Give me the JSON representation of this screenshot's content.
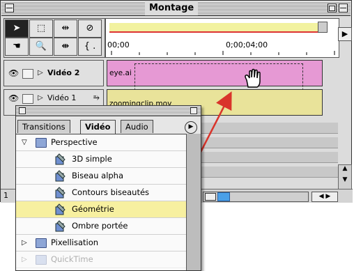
{
  "window": {
    "title": "Montage"
  },
  "ruler": {
    "time_start": "00;00",
    "time_mark": "0;00;04;00"
  },
  "tracks": [
    {
      "name": "Vidéo 2",
      "clip": "eye.ai"
    },
    {
      "name": "Vidéo 1",
      "clip": "zoomingclip.mov"
    }
  ],
  "bottom": {
    "left_label": "1"
  },
  "effects_palette": {
    "tabs": [
      "Transitions",
      "Vidéo",
      "Audio"
    ],
    "active_tab": "Vidéo",
    "items": [
      {
        "label": "Perspective",
        "type": "folder",
        "expanded": true
      },
      {
        "label": "3D simple",
        "type": "effect"
      },
      {
        "label": "Biseau alpha",
        "type": "effect"
      },
      {
        "label": "Contours biseautés",
        "type": "effect"
      },
      {
        "label": "Géométrie",
        "type": "effect",
        "highlighted": true
      },
      {
        "label": "Ombre portée",
        "type": "effect"
      },
      {
        "label": "Pixellisation",
        "type": "folder",
        "expanded": false
      },
      {
        "label": "QuickTime",
        "type": "folder",
        "expanded": false
      }
    ]
  },
  "colors": {
    "clip_ai": "#e699d4",
    "clip_mov": "#e9e39a",
    "highlight": "#f7f0a0",
    "arrow": "#d9342b"
  },
  "icons": [
    "eye-icon",
    "hand-cursor-icon",
    "folder-icon",
    "effect-icon",
    "disclosure-triangle-icon"
  ]
}
